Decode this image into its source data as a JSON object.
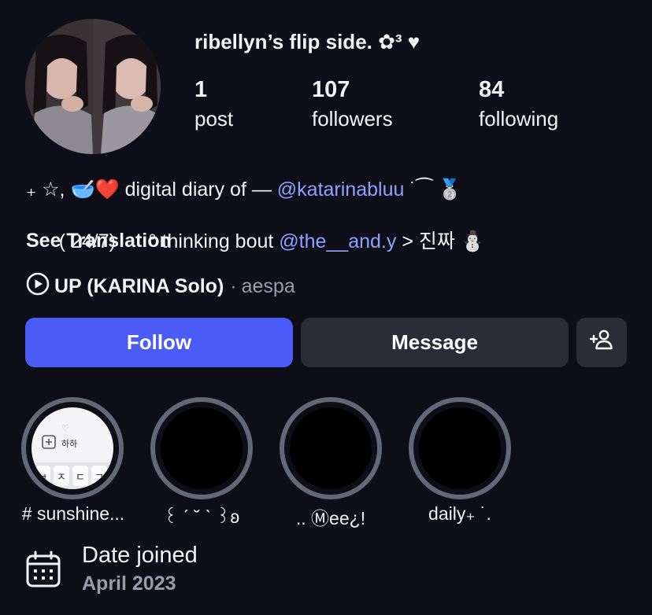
{
  "profile": {
    "username": "ribellyn’s flip side. ✿³ ♥",
    "stats": [
      {
        "value": "1",
        "label": "post"
      },
      {
        "value": "107",
        "label": "followers"
      },
      {
        "value": "84",
        "label": "following"
      }
    ]
  },
  "bio": {
    "line1_prefix": "₊ ☆, 🥣❤️ digital diary of — ",
    "line1_mention": "@katarinabluu",
    "line1_suffix": " ˙⁀ 🥈",
    "line2_prefix": "  ( 24/7)      ° thinking bout ",
    "line2_mention": "@the__and.y",
    "line2_suffix": " > 진짜 ⛄",
    "see_translation": "See Translation"
  },
  "music": {
    "song": "UP (KARINA Solo)",
    "separator": "·",
    "artist": "aespa",
    "icon": "play-circle-icon"
  },
  "buttons": {
    "follow": "Follow",
    "message": "Message",
    "add_person_icon": "add-person-icon"
  },
  "highlights": [
    {
      "label": "# sunshine...",
      "cover": "keyboard-screenshot"
    },
    {
      "label": "꒰ ˊ ˘ ˋ ꒱ʚ",
      "cover": "black"
    },
    {
      "label": ".. Ⓜee¿!",
      "cover": "black"
    },
    {
      "label": "daily₊ ˙.",
      "cover": "black"
    }
  ],
  "highlight_thumb": {
    "heart": "♡",
    "korean_word": "하하",
    "keys": [
      "ㅂ",
      "ㅈ",
      "ㄷ",
      "ㄱ"
    ]
  },
  "date_joined": {
    "title": "Date joined",
    "value": "April 2023",
    "icon": "calendar-icon"
  },
  "colors": {
    "background": "#0d0e18",
    "follow_button": "#4a5cf5",
    "secondary_button": "#2a2c37",
    "mention": "#8ea3ff",
    "muted_text": "#9a9cab",
    "highlight_ring": "#646775"
  }
}
